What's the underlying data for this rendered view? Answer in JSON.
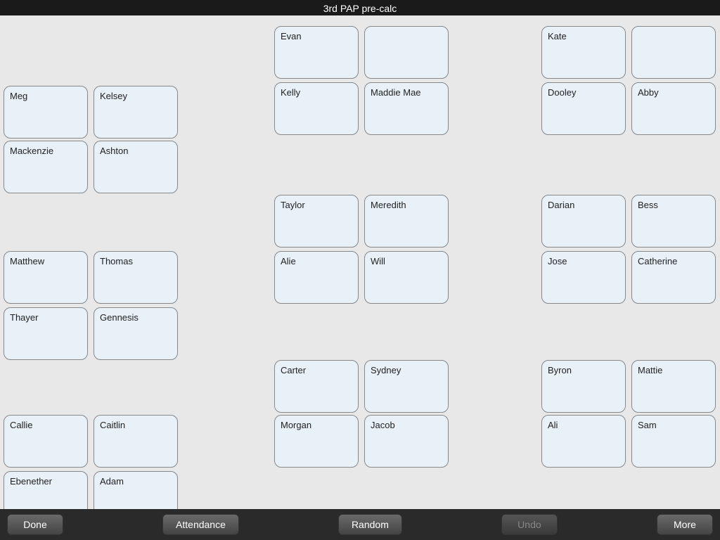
{
  "titleBar": {
    "title": "3rd PAP pre-calc"
  },
  "toolbar": {
    "done": "Done",
    "attendance": "Attendance",
    "random": "Random",
    "undo": "Undo",
    "more": "More"
  },
  "students": [
    {
      "name": "Evan",
      "col": 3,
      "row": 1
    },
    {
      "name": "",
      "col": 4,
      "row": 1
    },
    {
      "name": "Kate",
      "col": 7,
      "row": 1
    },
    {
      "name": "",
      "col": 8,
      "row": 1
    },
    {
      "name": "Kelly",
      "col": 3,
      "row": 2
    },
    {
      "name": "Maddie Mae",
      "col": 4,
      "row": 2
    },
    {
      "name": "Dooley",
      "col": 7,
      "row": 2
    },
    {
      "name": "Abby",
      "col": 8,
      "row": 2
    },
    {
      "name": "Meg",
      "col": 1,
      "row": 3
    },
    {
      "name": "Kelsey",
      "col": 2,
      "row": 3
    },
    {
      "name": "Mackenzie",
      "col": 1,
      "row": 4
    },
    {
      "name": "Ashton",
      "col": 2,
      "row": 4
    },
    {
      "name": "Taylor",
      "col": 3,
      "row": 5
    },
    {
      "name": "Meredith",
      "col": 4,
      "row": 5
    },
    {
      "name": "Darian",
      "col": 7,
      "row": 5
    },
    {
      "name": "Bess",
      "col": 8,
      "row": 5
    },
    {
      "name": "Matthew",
      "col": 1,
      "row": 6
    },
    {
      "name": "Thomas",
      "col": 2,
      "row": 6
    },
    {
      "name": "Alie",
      "col": 3,
      "row": 6
    },
    {
      "name": "Will",
      "col": 4,
      "row": 6
    },
    {
      "name": "Jose",
      "col": 7,
      "row": 6
    },
    {
      "name": "Catherine",
      "col": 8,
      "row": 6
    },
    {
      "name": "Thayer",
      "col": 1,
      "row": 7
    },
    {
      "name": "Gennesis",
      "col": 2,
      "row": 7
    },
    {
      "name": "Carter",
      "col": 3,
      "row": 8
    },
    {
      "name": "Sydney",
      "col": 4,
      "row": 8
    },
    {
      "name": "Byron",
      "col": 7,
      "row": 8
    },
    {
      "name": "Mattie",
      "col": 8,
      "row": 8
    },
    {
      "name": "Callie",
      "col": 1,
      "row": 9
    },
    {
      "name": "Caitlin",
      "col": 2,
      "row": 9
    },
    {
      "name": "Morgan",
      "col": 3,
      "row": 9
    },
    {
      "name": "Jacob",
      "col": 4,
      "row": 9
    },
    {
      "name": "Ali",
      "col": 7,
      "row": 9
    },
    {
      "name": "Sam",
      "col": 8,
      "row": 9
    },
    {
      "name": "Ebenether",
      "col": 1,
      "row": 10
    },
    {
      "name": "Adam",
      "col": 2,
      "row": 10
    }
  ],
  "layout": {
    "cardWidth": 120,
    "cardHeight": 75,
    "colGap": 8,
    "rowGap": 6,
    "colStarts": [
      0,
      5,
      130,
      265,
      390,
      520,
      645,
      770,
      895
    ],
    "rowStarts": [
      0,
      10,
      96,
      182,
      268,
      354,
      440,
      526,
      612,
      698
    ]
  }
}
